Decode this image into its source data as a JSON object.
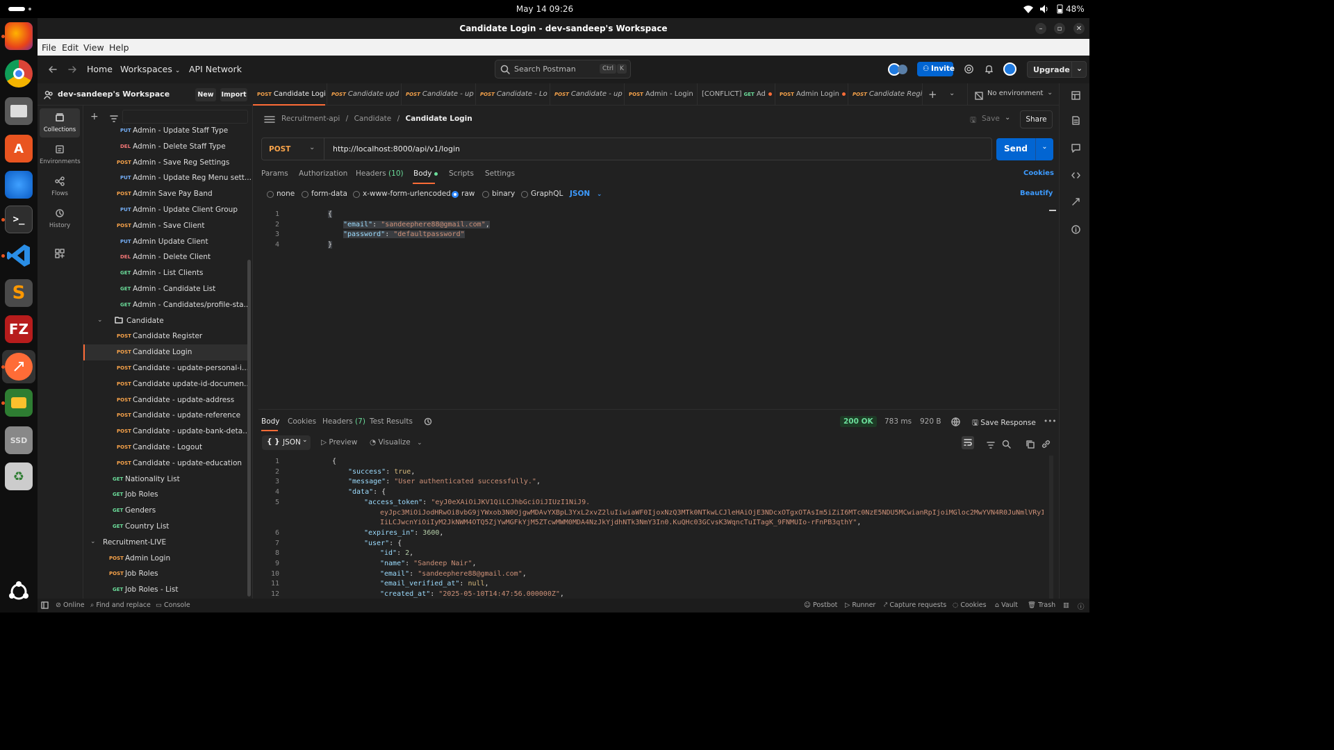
{
  "system": {
    "date_time": "May 14  09:26",
    "battery": "48%"
  },
  "window": {
    "title": "Candidate Login - dev-sandeep's Workspace"
  },
  "menu": [
    "File",
    "Edit",
    "View",
    "Help"
  ],
  "header": {
    "home": "Home",
    "workspaces": "Workspaces",
    "api_network": "API Network",
    "search_placeholder": "Search Postman",
    "shortcut_ctrl": "Ctrl",
    "shortcut_k": "K",
    "invite": "Invite",
    "upgrade": "Upgrade"
  },
  "workspace": {
    "name": "dev-sandeep's Workspace",
    "new_label": "New",
    "import_label": "Import"
  },
  "rail": [
    {
      "label": "Collections",
      "icon": "collections-icon"
    },
    {
      "label": "Environments",
      "icon": "environments-icon"
    },
    {
      "label": "Flows",
      "icon": "flows-icon"
    },
    {
      "label": "History",
      "icon": "history-icon"
    }
  ],
  "tree": [
    {
      "method": "PUT",
      "label": "Admin - Update Staff Type",
      "indent": 2
    },
    {
      "method": "DEL",
      "label": "Admin - Delete Staff Type",
      "indent": 2
    },
    {
      "method": "POST",
      "label": "Admin - Save Reg Settings",
      "indent": 2
    },
    {
      "method": "PUT",
      "label": "Admin - Update Reg Menu sett...",
      "indent": 2
    },
    {
      "method": "POST",
      "label": "Admin Save Pay Band",
      "indent": 2
    },
    {
      "method": "PUT",
      "label": "Admin - Update Client Group",
      "indent": 2
    },
    {
      "method": "POST",
      "label": "Admin - Save Client",
      "indent": 2
    },
    {
      "method": "PUT",
      "label": "Admin Update Client",
      "indent": 2
    },
    {
      "method": "DEL",
      "label": "Admin - Delete Client",
      "indent": 2
    },
    {
      "method": "GET",
      "label": "Admin - List Clients",
      "indent": 2
    },
    {
      "method": "GET",
      "label": "Admin - Candidate List",
      "indent": 2
    },
    {
      "method": "GET",
      "label": "Admin - Candidates/profile-sta...",
      "indent": 2
    },
    {
      "folder": true,
      "label": "Candidate",
      "indent": 1
    },
    {
      "method": "POST",
      "label": "Candidate Register",
      "indent": 2
    },
    {
      "method": "POST",
      "label": "Candidate Login",
      "indent": 2,
      "active": true
    },
    {
      "method": "POST",
      "label": "Candidate - update-personal-i...",
      "indent": 2
    },
    {
      "method": "POST",
      "label": "Candidate update-id-documen...",
      "indent": 2
    },
    {
      "method": "POST",
      "label": "Candidate - update-address",
      "indent": 2
    },
    {
      "method": "POST",
      "label": "Candidate - update-reference",
      "indent": 2
    },
    {
      "method": "POST",
      "label": "Candidate - update-bank-deta...",
      "indent": 2
    },
    {
      "method": "POST",
      "label": "Candidate - Logout",
      "indent": 2
    },
    {
      "method": "POST",
      "label": "Candidate - update-education",
      "indent": 2
    },
    {
      "method": "GET",
      "label": "Nationality List",
      "indent": 1
    },
    {
      "method": "GET",
      "label": "Job Roles",
      "indent": 1
    },
    {
      "method": "GET",
      "label": "Genders",
      "indent": 1
    },
    {
      "method": "GET",
      "label": "Country List",
      "indent": 1
    },
    {
      "collection": true,
      "label": "Recruitment-LIVE",
      "indent": 0
    },
    {
      "method": "POST",
      "label": "Admin Login",
      "indent": 1
    },
    {
      "method": "POST",
      "label": "Job Roles",
      "indent": 1
    },
    {
      "method": "GET",
      "label": "Job Roles - List",
      "indent": 1
    }
  ],
  "tabs": [
    {
      "method": "POST",
      "label": "Candidate Logi",
      "active": true
    },
    {
      "method": "POST",
      "label": "Candidate upd",
      "italic": true
    },
    {
      "method": "POST",
      "label": "Candidate - up",
      "italic": true
    },
    {
      "method": "POST",
      "label": "Candidate - Lo",
      "italic": true
    },
    {
      "method": "POST",
      "label": "Candidate - up",
      "italic": true
    },
    {
      "method": "POST",
      "label": "Admin - Login"
    },
    {
      "prefix": "[CONFLICT]",
      "method": "GET",
      "label": "Ad",
      "dot": true
    },
    {
      "method": "POST",
      "label": "Admin Login",
      "dot": true
    },
    {
      "method": "POST",
      "label": "Candidate Regi",
      "italic": true
    }
  ],
  "environment": "No environment",
  "breadcrumb": {
    "collection": "Recruitment-api",
    "folder": "Candidate",
    "request": "Candidate Login"
  },
  "request": {
    "save": "Save",
    "share": "Share",
    "method": "POST",
    "url": "http://localhost:8000/api/v1/login",
    "send": "Send"
  },
  "req_tabs": {
    "params": "Params",
    "authorization": "Authorization",
    "headers": "Headers",
    "headers_count": "(10)",
    "body": "Body",
    "scripts": "Scripts",
    "settings": "Settings",
    "cookies": "Cookies"
  },
  "body_types": {
    "none": "none",
    "form_data": "form-data",
    "urlencoded": "x-www-form-urlencoded",
    "raw": "raw",
    "binary": "binary",
    "graphql": "GraphQL",
    "format": "JSON",
    "beautify": "Beautify"
  },
  "req_code": [
    {
      "n": "1",
      "t": "{"
    },
    {
      "n": "2",
      "key": "\"email\"",
      "val": "\"sandeephere88@gmail.com\"",
      "tail": ","
    },
    {
      "n": "3",
      "key": "\"password\"",
      "val": "\"defaultpassword\""
    },
    {
      "n": "4",
      "t": "}"
    }
  ],
  "response": {
    "tabs": {
      "body": "Body",
      "cookies": "Cookies",
      "headers": "Headers",
      "headers_count": "(7)",
      "tests": "Test Results"
    },
    "status": "200 OK",
    "time": "783 ms",
    "size": "920 B",
    "save_response": "Save Response",
    "format": "JSON",
    "preview": "Preview",
    "visualize": "Visualize"
  },
  "res_code": [
    {
      "n": "1",
      "i": 0,
      "t": "{"
    },
    {
      "n": "2",
      "i": 1,
      "key": "\"success\"",
      "kw": "true",
      "tail": ","
    },
    {
      "n": "3",
      "i": 1,
      "key": "\"message\"",
      "val": "\"User authenticated successfully.\"",
      "tail": ","
    },
    {
      "n": "4",
      "i": 1,
      "key": "\"data\"",
      "t": ": {"
    },
    {
      "n": "5",
      "i": 2,
      "key": "\"access_token\"",
      "val": "\"eyJ0eXAiOiJKV1QiLCJhbGciOiJIUzI1NiJ9."
    },
    {
      "n": "",
      "i": 3,
      "val": "eyJpc3MiOiJodHRwOi8vbG9jYWxob3N0OjgwMDAvYXBpL3YxL2xvZ2luIiwiaWF0IjoxNzQ3MTk0NTkwLCJleHAiOjE3NDcxOTgxOTAsIm5iZiI6MTc0NzE5NDU5MCwianRpIjoiMGloc2MwYVN4R0JuNmlVRyIsInN1YiI6Ij"
    },
    {
      "n": "",
      "i": 3,
      "val": "IiLCJwcnYiOiIyM2JkNWM4OTQ5ZjYwMGFkYjM5ZTcwMWM0MDA4NzJkYjdhNTk3NmY3In0.KuQHc03GCvsK3WqncTuITagK_9FNMUIo-rFnPB3qthY\"",
      "tail": ","
    },
    {
      "n": "6",
      "i": 2,
      "key": "\"expires_in\"",
      "num": "3600",
      "tail": ","
    },
    {
      "n": "7",
      "i": 2,
      "key": "\"user\"",
      "t": ": {"
    },
    {
      "n": "8",
      "i": 3,
      "key": "\"id\"",
      "num": "2",
      "tail": ","
    },
    {
      "n": "9",
      "i": 3,
      "key": "\"name\"",
      "val": "\"Sandeep Nair\"",
      "tail": ","
    },
    {
      "n": "10",
      "i": 3,
      "key": "\"email\"",
      "val": "\"sandeephere88@gmail.com\"",
      "tail": ","
    },
    {
      "n": "11",
      "i": 3,
      "key": "\"email_verified_at\"",
      "kw": "null",
      "tail": ","
    },
    {
      "n": "12",
      "i": 3,
      "key": "\"created_at\"",
      "val": "\"2025-05-10T14:47:56.000000Z\"",
      "tail": ","
    }
  ],
  "statusbar": {
    "online": "Online",
    "find": "Find and replace",
    "console": "Console",
    "postbot": "Postbot",
    "runner": "Runner",
    "capture": "Capture requests",
    "cookies": "Cookies",
    "vault": "Vault",
    "trash": "Trash"
  },
  "colors": {
    "accent": "#0265d2",
    "orange": "#ff6c37",
    "post": "#f8a34a",
    "get": "#6bdd9a",
    "put": "#74aef6",
    "del": "#f47676"
  }
}
